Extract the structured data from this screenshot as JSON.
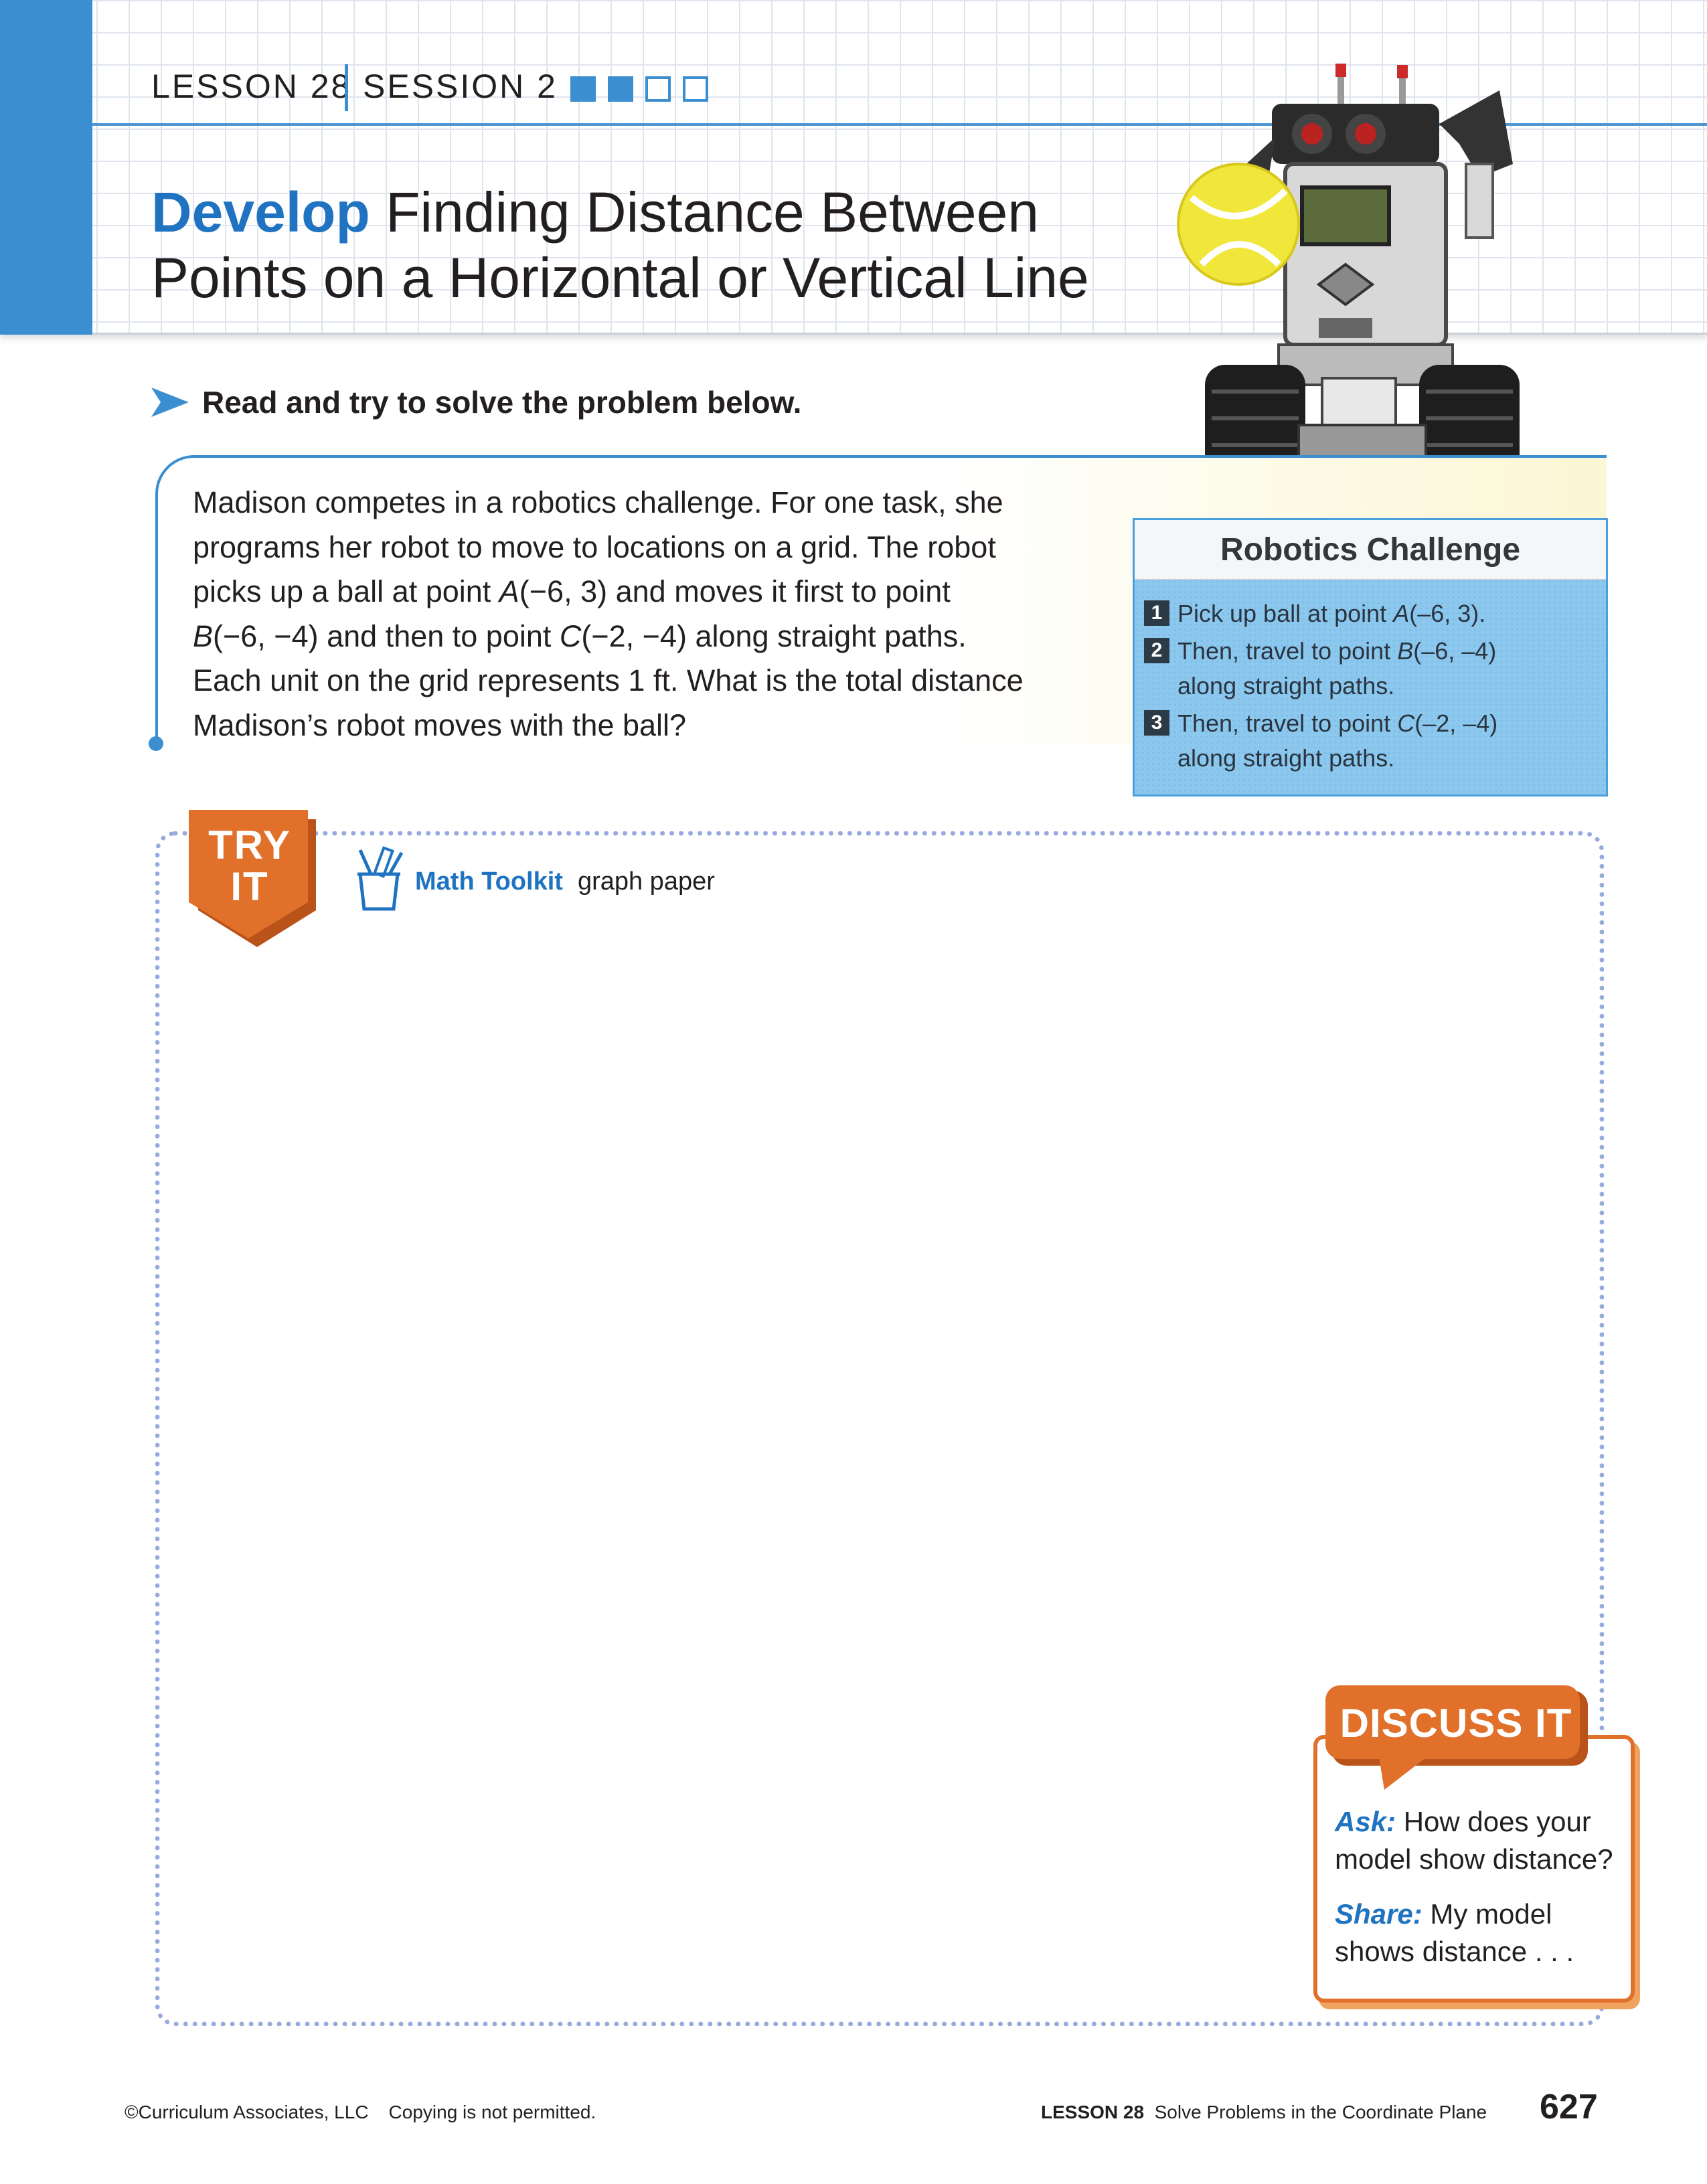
{
  "header": {
    "lesson": "LESSON 28",
    "session": "SESSION 2",
    "session_progress": {
      "completed": 2,
      "total": 4
    },
    "title_lead": "Develop",
    "title_rest_line1": " Finding Distance Between",
    "title_line2": "Points on a Horizontal or Vertical Line",
    "accent_color": "#3b8ed0"
  },
  "instruction": {
    "icon": "arrow-right-icon",
    "text": "Read and try to solve the problem below."
  },
  "problem": {
    "lines": [
      "Madison competes in a robotics challenge. For one task, she",
      "programs her robot to move to locations on a grid. The robot",
      "picks up a ball at point A(−6, 3) and moves it first to point",
      "B(−6, −4) and then to point C(−2, −4) along straight paths.",
      "Each unit on the grid represents 1 ft. What is the total distance",
      "Madison’s robot moves with the ball?"
    ]
  },
  "challenge": {
    "title": "Robotics Challenge",
    "items": [
      {
        "num": "1",
        "lines": [
          "Pick up ball at point A(–6, 3)."
        ]
      },
      {
        "num": "2",
        "lines": [
          "Then, travel to point B(–6, –4)",
          "along straight paths."
        ]
      },
      {
        "num": "3",
        "lines": [
          "Then, travel to point C(–2, –4)",
          "along straight paths."
        ]
      }
    ]
  },
  "try_it": {
    "badge_line1": "TRY",
    "badge_line2": "IT",
    "toolkit_icon": "pencil-cup-icon",
    "toolkit_label": "Math Toolkit",
    "toolkit_item": "graph paper",
    "badge_color": "#e0702a"
  },
  "discuss": {
    "title": "DISCUSS IT",
    "ask_lead": "Ask:",
    "ask_line1": " How does your",
    "ask_line2": "model show distance?",
    "share_lead": "Share:",
    "share_line1": " My model",
    "share_line2": "shows distance . . ."
  },
  "footer": {
    "copyright": "©Curriculum Associates, LLC",
    "notice": "Copying is not permitted.",
    "lesson": "LESSON 28",
    "lesson_title": "Solve Problems in the Coordinate Plane",
    "page_number": "627"
  }
}
